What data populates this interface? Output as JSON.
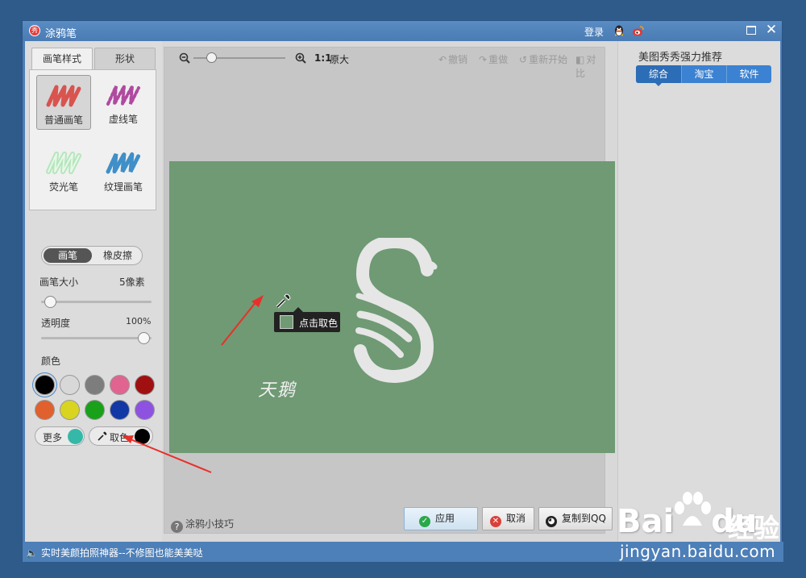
{
  "window": {
    "title": "涂鸦笔",
    "login": "登录",
    "status": "实时美颜拍照神器--不修图也能美美哒"
  },
  "left": {
    "tabs": [
      "画笔样式",
      "形状"
    ],
    "brushes": [
      "普通画笔",
      "虚线笔",
      "荧光笔",
      "纹理画笔"
    ],
    "modes": [
      "画笔",
      "橡皮擦"
    ],
    "size_label": "画笔大小",
    "size_value": "5像素",
    "size_level": 0.05,
    "opacity_label": "透明度",
    "opacity_value": "100%",
    "opacity_level": 1.0,
    "color_label": "颜色",
    "colors": [
      "#000000",
      "#d8d8d8",
      "#7d7d7d",
      "#e0648f",
      "#a01010",
      "#e0602e",
      "#d8d420",
      "#1aa11a",
      "#1238a6",
      "#8e52e0"
    ],
    "more_label": "更多",
    "more_color": "#36b8a8",
    "pick_label": "取色",
    "pick_color": "#000000"
  },
  "toolbar": {
    "zoom_ratio": "1:1",
    "zoom_orig": "原大",
    "undo": "撤销",
    "redo": "重做",
    "restart": "重新开始",
    "compare": "对比"
  },
  "canvas": {
    "bg_color": "#6f9a74",
    "signature": "天鹅",
    "picker_tip": "点击取色"
  },
  "bottom": {
    "tips": "涂鸦小技巧",
    "apply": "应用",
    "cancel": "取消",
    "copy_qq": "复制到QQ"
  },
  "right": {
    "title": "美图秀秀强力推荐",
    "tabs": [
      "综合",
      "淘宝",
      "软件"
    ]
  },
  "watermark": {
    "brand": "Bai",
    "brand2": "du",
    "jingyan": "经验",
    "url": "jingyan.baidu.com"
  }
}
